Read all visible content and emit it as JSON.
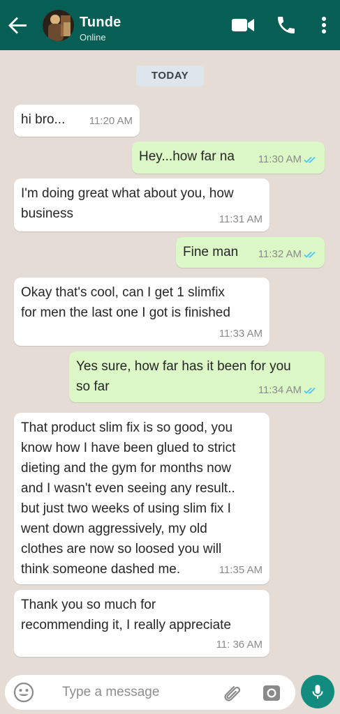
{
  "header": {
    "contact_name": "Tunde",
    "status": "Online",
    "icons": [
      "back-arrow-icon",
      "video-camera-icon",
      "phone-icon",
      "more-vert-icon"
    ],
    "color": "#075e54"
  },
  "chat": {
    "date_label": "TODAY",
    "messages": [
      {
        "dir": "in",
        "lines": [
          "hi bro..."
        ],
        "time": "11:20 AM"
      },
      {
        "dir": "out",
        "lines": [
          "Hey...how far na"
        ],
        "time": "11:30 AM",
        "read": true
      },
      {
        "dir": "in",
        "lines": [
          "I'm doing great what about you, how",
          "business"
        ],
        "time": "11:31 AM"
      },
      {
        "dir": "out",
        "lines": [
          "Fine man"
        ],
        "time": "11:32 AM",
        "read": true
      },
      {
        "dir": "in",
        "lines": [
          "Okay that's cool, can I get 1 slimfix",
          "for men the last one I got is finished"
        ],
        "time": "11:33 AM"
      },
      {
        "dir": "out",
        "lines": [
          "Yes sure, how far has it been for you",
          "so far"
        ],
        "time": "11:34 AM",
        "read": true
      },
      {
        "dir": "in",
        "lines": [
          "That product slim fix is so good, you",
          "know how I have been glued to strict",
          "dieting and the gym for months now",
          "and I wasn't even seeing any result..",
          "but just two weeks of using slim fix I",
          "went down aggressively, my old",
          "clothes are now so loosed you will",
          "think someone dashed me."
        ],
        "time": "11:35 AM"
      },
      {
        "dir": "in",
        "lines": [
          "Thank you so much for",
          "recommending it, I really appreciate"
        ],
        "time": "11: 36 AM"
      }
    ],
    "bubble_colors": {
      "in": "#ffffff",
      "out": "#dcf8c6"
    },
    "tick_color": "#4fc3f7"
  },
  "composer": {
    "placeholder": "Type a message",
    "icons": [
      "emoji-icon",
      "paperclip-icon",
      "camera-icon",
      "mic-icon"
    ],
    "mic_color": "#128c7e"
  }
}
